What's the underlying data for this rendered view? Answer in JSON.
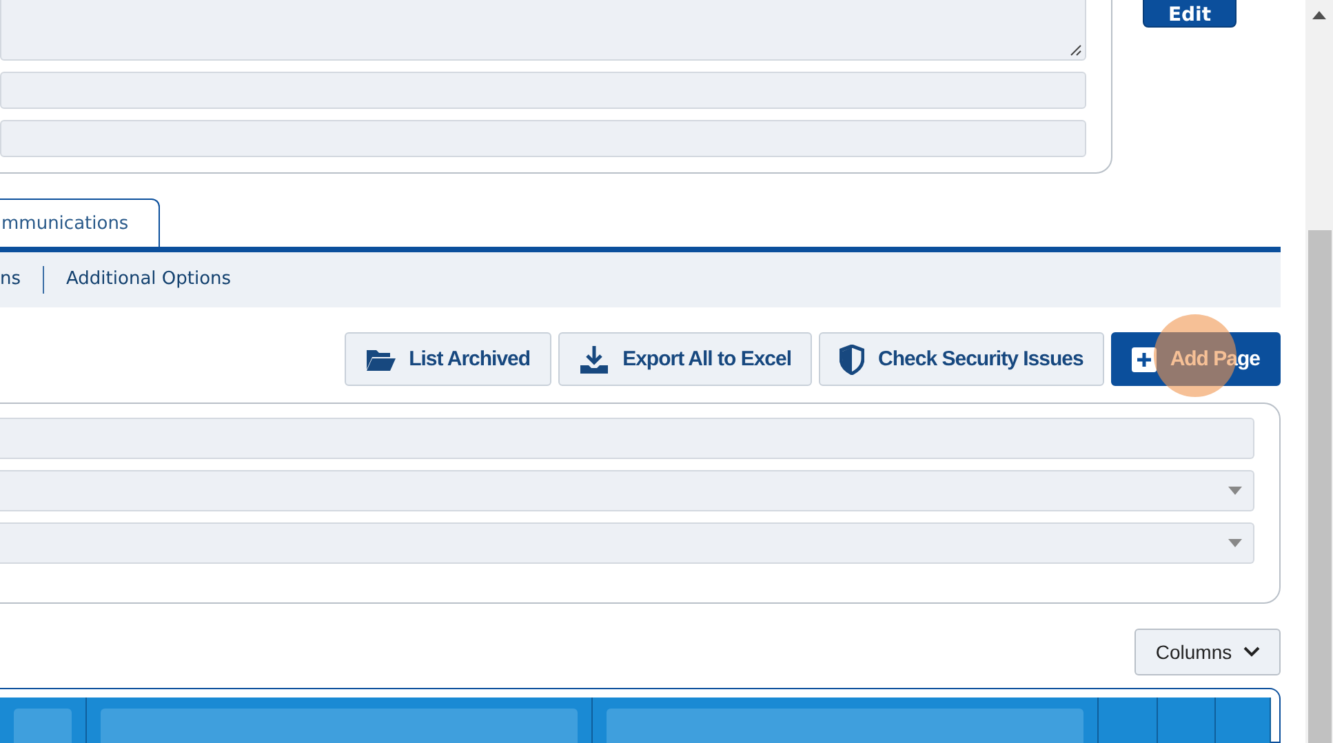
{
  "top_form": {
    "fields": [
      {
        "kind": "textarea"
      },
      {
        "kind": "text"
      },
      {
        "kind": "text"
      }
    ],
    "edit_button": "Edit"
  },
  "tabs": [
    {
      "label": "mmunications",
      "selected": true
    }
  ],
  "subnav": [
    "ns",
    "Additional Options"
  ],
  "actions": [
    {
      "label": "List Archived",
      "kind": "folder",
      "primary": false
    },
    {
      "label": "Export All to Excel",
      "kind": "download",
      "primary": false
    },
    {
      "label": "Check Security Issues",
      "kind": "shield",
      "primary": false
    },
    {
      "label": "Add Page",
      "kind": "plus",
      "primary": true,
      "highlighted": true
    }
  ],
  "filters": [
    {
      "kind": "text"
    },
    {
      "kind": "select"
    },
    {
      "kind": "select"
    }
  ],
  "columns_button": "Columns",
  "table": {
    "columns": [
      {
        "kind": "filter"
      },
      {
        "kind": "filter"
      },
      {
        "kind": "filter"
      },
      {
        "kind": "blank"
      },
      {
        "kind": "blank"
      },
      {
        "kind": "blank"
      }
    ]
  }
}
